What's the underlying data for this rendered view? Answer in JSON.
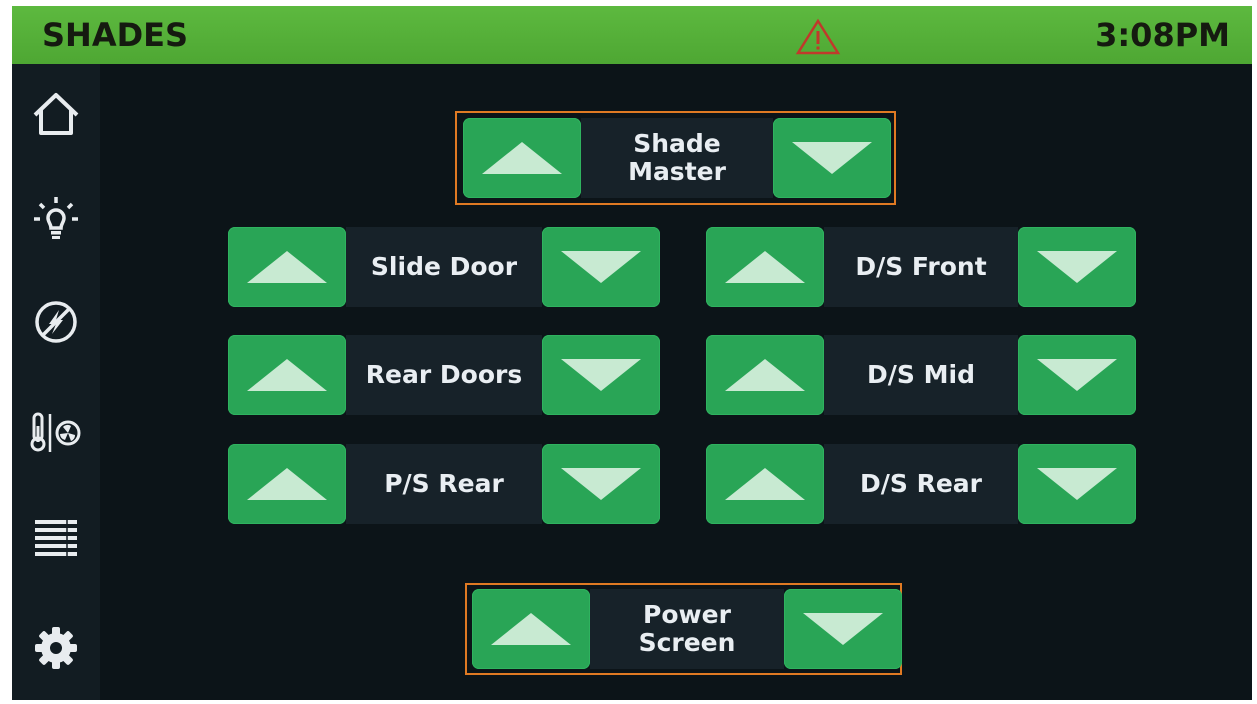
{
  "header": {
    "title": "SHADES",
    "time": "3:08PM",
    "alert_icon": "warning-triangle-icon"
  },
  "sidebar": {
    "items": [
      {
        "name": "home",
        "icon": "home-icon"
      },
      {
        "name": "lights",
        "icon": "light-bulb-icon"
      },
      {
        "name": "power",
        "icon": "power-bolt-icon"
      },
      {
        "name": "climate",
        "icon": "thermometer-fan-icon"
      },
      {
        "name": "shades",
        "icon": "blinds-icon",
        "active": true
      },
      {
        "name": "settings",
        "icon": "gear-icon"
      }
    ]
  },
  "shades": {
    "master": {
      "line1": "Shade",
      "line2": "Master"
    },
    "slide_door": {
      "label": "Slide Door"
    },
    "ds_front": {
      "label": "D/S Front"
    },
    "rear_doors": {
      "label": "Rear Doors"
    },
    "ds_mid": {
      "label": "D/S Mid"
    },
    "ps_rear": {
      "label": "P/S Rear"
    },
    "ds_rear": {
      "label": "D/S Rear"
    },
    "power_screen": {
      "line1": "Power",
      "line2": "Screen"
    }
  },
  "colors": {
    "header_green": "#4ea733",
    "button_green": "#29a556",
    "arrow": "#c8ead2",
    "highlight_border": "#e07a23",
    "background": "#0c1418"
  }
}
